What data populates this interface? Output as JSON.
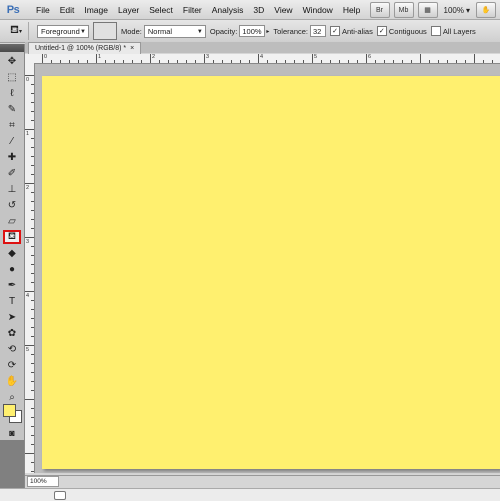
{
  "app": {
    "logo": "Ps"
  },
  "menu": [
    "File",
    "Edit",
    "Image",
    "Layer",
    "Select",
    "Filter",
    "Analysis",
    "3D",
    "View",
    "Window",
    "Help"
  ],
  "menubar_right": {
    "btn1": "Br",
    "btn2": "Mb",
    "zoom": "100%"
  },
  "options": {
    "fill_source": "Foreground",
    "mode_label": "Mode:",
    "mode_value": "Normal",
    "opacity_label": "Opacity:",
    "opacity_value": "100%",
    "tolerance_label": "Tolerance:",
    "tolerance_value": "32",
    "antialias_label": "Anti-alias",
    "antialias_checked": true,
    "contiguous_label": "Contiguous",
    "contiguous_checked": true,
    "all_layers_label": "All Layers",
    "all_layers_checked": false
  },
  "document": {
    "tab_title": "Untitled-1 @ 100% (RGB/8) *",
    "close": "×"
  },
  "canvas": {
    "fill_color": "#fff06f"
  },
  "tools": [
    {
      "name": "move-tool-icon",
      "glyph": "✥"
    },
    {
      "name": "marquee-tool-icon",
      "glyph": "⬚"
    },
    {
      "name": "lasso-tool-icon",
      "glyph": "ℓ"
    },
    {
      "name": "quick-selection-tool-icon",
      "glyph": "✎"
    },
    {
      "name": "crop-tool-icon",
      "glyph": "⌗"
    },
    {
      "name": "eyedropper-tool-icon",
      "glyph": "⁄"
    },
    {
      "name": "healing-brush-tool-icon",
      "glyph": "✚"
    },
    {
      "name": "brush-tool-icon",
      "glyph": "✐"
    },
    {
      "name": "clone-stamp-tool-icon",
      "glyph": "⊥"
    },
    {
      "name": "history-brush-tool-icon",
      "glyph": "↺"
    },
    {
      "name": "eraser-tool-icon",
      "glyph": "▱"
    },
    {
      "name": "paint-bucket-tool-icon",
      "glyph": "⛾",
      "active": true
    },
    {
      "name": "blur-tool-icon",
      "glyph": "◆"
    },
    {
      "name": "dodge-tool-icon",
      "glyph": "●"
    },
    {
      "name": "pen-tool-icon",
      "glyph": "✒"
    },
    {
      "name": "type-tool-icon",
      "glyph": "T"
    },
    {
      "name": "path-selection-tool-icon",
      "glyph": "➤"
    },
    {
      "name": "shape-tool-icon",
      "glyph": "✿"
    },
    {
      "name": "3d-rotate-tool-icon",
      "glyph": "⟲"
    },
    {
      "name": "3d-orbit-tool-icon",
      "glyph": "⟳"
    },
    {
      "name": "hand-tool-icon",
      "glyph": "✋"
    },
    {
      "name": "zoom-tool-icon",
      "glyph": "⌕"
    }
  ],
  "swatches": {
    "foreground": "#fff06f",
    "background": "#ffffff"
  },
  "rulers": {
    "top": [
      "0",
      "1",
      "2",
      "3",
      "4",
      "5",
      "6"
    ],
    "left": [
      "0",
      "1",
      "2",
      "3",
      "4",
      "5"
    ]
  },
  "status": {
    "zoom": "100%"
  }
}
